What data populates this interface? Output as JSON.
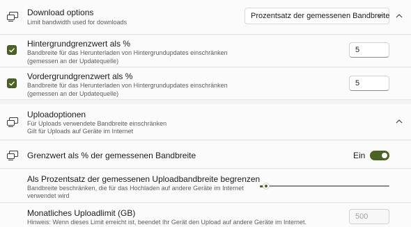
{
  "download": {
    "title": "Download options",
    "description": "Limit bandwidth used for downloads",
    "mode_selected": "Prozentsatz der gemessenen Bandbreite",
    "icon": "download-options-icon"
  },
  "background_limit": {
    "checked": true,
    "title": "Hintergrundgrenzwert als %",
    "desc_line1": "Bandbreite für das Herunterladen von Hintergrundupdates einschränken",
    "desc_line2": "(gemessen an der Updatequelle)",
    "value": "5"
  },
  "foreground_limit": {
    "checked": true,
    "title": "Vordergrundgrenzwert als %",
    "desc_line1": "Bandbreite für das Herunterladen von Hintergrundupdates einschränken",
    "desc_line2": "(gemessen an der Updatequelle)",
    "value": "5"
  },
  "upload": {
    "title": "Uploadoptionen",
    "desc_line1": "Für Uploads verwendete Bandbreite einschränken",
    "desc_line2": "Gilt für Uploads auf Geräte im Internet",
    "icon": "upload-options-icon"
  },
  "measured_limit": {
    "title": "Grenzwert als % der gemessenen Bandbreite",
    "toggle_label": "Ein",
    "toggle_on": true
  },
  "upload_percent": {
    "title": "Als Prozentsatz der gemessenen Uploadbandbreite begrenzen",
    "desc_line1": "Bandbreite beschränken, die für das Hochladen auf andere Geräte im Internet",
    "desc_line2": "verwendet wird",
    "slider_fraction": 0.05
  },
  "monthly_limit": {
    "title": "Monatliches Uploadlimit (GB)",
    "description": "Hinweis: Wenn dieses Limit erreicht ist, beendet Ihr Gerät den Upload auf andere Geräte im Internet.",
    "value": "500"
  },
  "colors": {
    "accent": "#4c6324",
    "card": "#fbfbfb",
    "background": "#f3f3f3"
  }
}
